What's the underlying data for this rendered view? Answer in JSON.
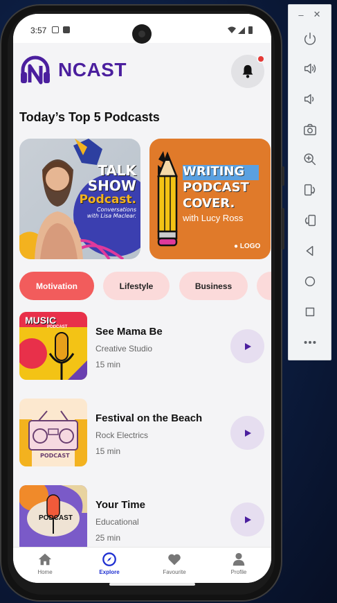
{
  "status_bar": {
    "time": "3:57"
  },
  "app": {
    "brand": "NCAST"
  },
  "section": {
    "title": "Today’s Top 5 Podcasts"
  },
  "covers": [
    {
      "lines": [
        "TALK",
        "SHOW",
        "Podcast."
      ],
      "subtitle": "Conversations\nwith Lisa Maclear."
    },
    {
      "lines": [
        "WRITING",
        "PODCAST",
        "COVER."
      ],
      "subtitle": "with Lucy Ross",
      "logo": "LOGO"
    }
  ],
  "categories": [
    {
      "label": "Motivation",
      "active": true
    },
    {
      "label": "Lifestyle",
      "active": false
    },
    {
      "label": "Business",
      "active": false
    }
  ],
  "podcasts": [
    {
      "title": "See Mama Be",
      "artist": "Creative Studio",
      "duration": "15 min",
      "art_text": [
        "MUSIC",
        "PODCAST"
      ]
    },
    {
      "title": "Festival on the Beach",
      "artist": "Rock Electrics",
      "duration": "15 min",
      "art_text": [
        "PODCAST"
      ]
    },
    {
      "title": "Your Time",
      "artist": "Educational",
      "duration": "25 min",
      "art_text": [
        "PODCAST"
      ]
    }
  ],
  "nav": [
    {
      "label": "Home",
      "icon": "home-icon",
      "active": false
    },
    {
      "label": "Explore",
      "icon": "compass-icon",
      "active": true
    },
    {
      "label": "Favourite",
      "icon": "heart-icon",
      "active": false
    },
    {
      "label": "Profile",
      "icon": "person-icon",
      "active": false
    }
  ],
  "colors": {
    "brand": "#4b1f9e",
    "accent": "#f25c5c",
    "chip_idle": "#fbdada",
    "nav_active": "#1e2fd1",
    "notification": "#e53935"
  },
  "emulator": {
    "window_controls": [
      "minimize-icon",
      "close-icon"
    ],
    "tools": [
      "power-icon",
      "volume-up-icon",
      "volume-down-icon",
      "camera-icon",
      "zoom-icon",
      "rotate-left-icon",
      "rotate-right-icon",
      "back-icon",
      "home-circle-icon",
      "overview-icon",
      "more-icon"
    ]
  }
}
